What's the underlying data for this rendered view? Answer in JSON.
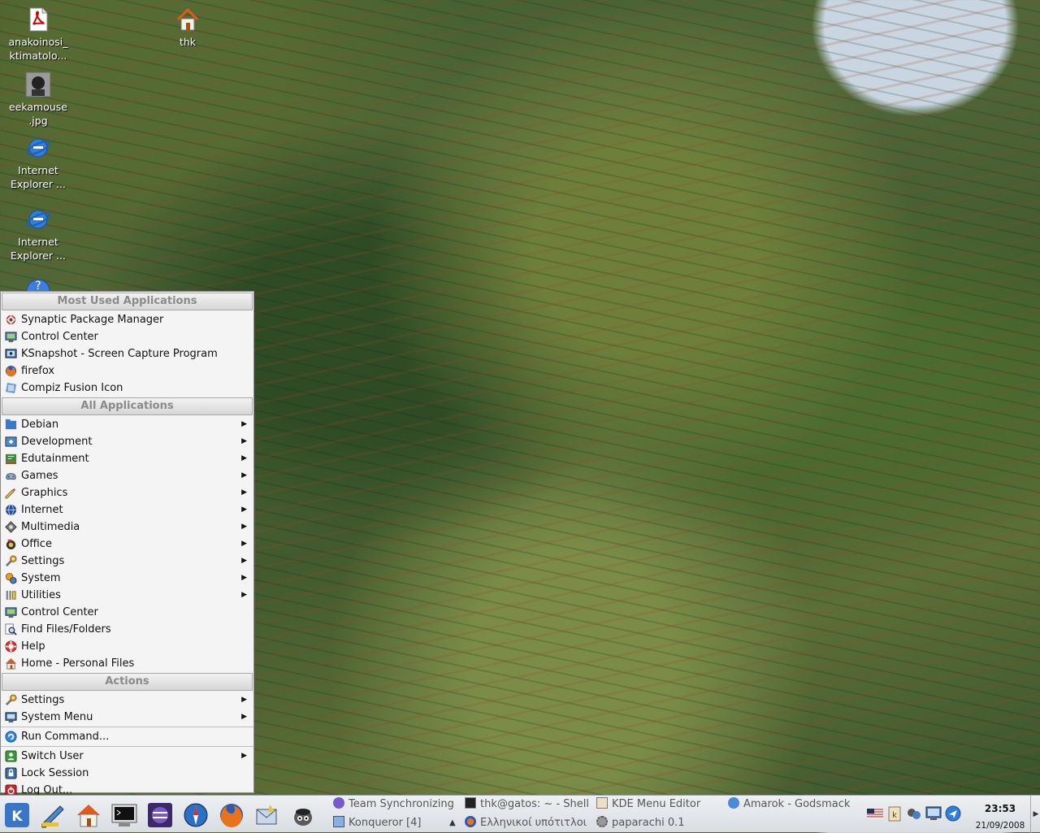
{
  "desktop": {
    "icons": [
      {
        "label_line1": "anakoinosi_",
        "label_line2": "ktimatolo...",
        "icon": "pdf-icon"
      },
      {
        "label_line1": "thk",
        "label_line2": "",
        "icon": "home-folder-icon"
      },
      {
        "label_line1": "eekamouse",
        "label_line2": ".jpg",
        "icon": "image-icon"
      },
      {
        "label_line1": "Internet",
        "label_line2": "Explorer ...",
        "icon": "internet-explorer-icon"
      },
      {
        "label_line1": "Internet",
        "label_line2": "Explorer ...",
        "icon": "internet-explorer-icon"
      }
    ]
  },
  "menu": {
    "sections": {
      "most_used": "Most Used Applications",
      "all_apps": "All Applications",
      "actions": "Actions"
    },
    "most_used": [
      {
        "label": "Synaptic Package Manager",
        "icon": "package-icon"
      },
      {
        "label": "Control Center",
        "icon": "control-center-icon"
      },
      {
        "label": "KSnapshot - Screen Capture Program",
        "icon": "camera-icon"
      },
      {
        "label": "firefox",
        "icon": "firefox-icon"
      },
      {
        "label": "Compiz Fusion Icon",
        "icon": "compiz-icon"
      }
    ],
    "all_apps": [
      {
        "label": "Debian",
        "icon": "debian-icon",
        "submenu": true
      },
      {
        "label": "Development",
        "icon": "development-icon",
        "submenu": true
      },
      {
        "label": "Edutainment",
        "icon": "edutainment-icon",
        "submenu": true
      },
      {
        "label": "Games",
        "icon": "games-icon",
        "submenu": true
      },
      {
        "label": "Graphics",
        "icon": "graphics-icon",
        "submenu": true
      },
      {
        "label": "Internet",
        "icon": "internet-icon",
        "submenu": true
      },
      {
        "label": "Multimedia",
        "icon": "multimedia-icon",
        "submenu": true
      },
      {
        "label": "Office",
        "icon": "office-icon",
        "submenu": true
      },
      {
        "label": "Settings",
        "icon": "settings-icon",
        "submenu": true
      },
      {
        "label": "System",
        "icon": "system-icon",
        "submenu": true
      },
      {
        "label": "Utilities",
        "icon": "utilities-icon",
        "submenu": true
      },
      {
        "label": "Control Center",
        "icon": "control-center-icon",
        "submenu": false
      },
      {
        "label": "Find Files/Folders",
        "icon": "find-icon",
        "submenu": false
      },
      {
        "label": "Help",
        "icon": "help-icon",
        "submenu": false
      },
      {
        "label": "Home - Personal Files",
        "icon": "home-icon",
        "submenu": false
      }
    ],
    "actions": [
      {
        "label": "Settings",
        "icon": "settings-icon",
        "submenu": true
      },
      {
        "label": "System Menu",
        "icon": "system-menu-icon",
        "submenu": true
      }
    ],
    "run_command": {
      "label": "Run Command...",
      "icon": "run-icon"
    },
    "session": [
      {
        "label": "Switch User",
        "icon": "switch-user-icon",
        "submenu": true
      },
      {
        "label": "Lock Session",
        "icon": "lock-icon",
        "submenu": false
      },
      {
        "label": "Log Out...",
        "icon": "logout-icon",
        "submenu": false
      }
    ]
  },
  "taskbar": {
    "launchers": [
      "kde-menu-icon",
      "kwrite-icon",
      "home-icon",
      "terminal-icon",
      "eclipse-icon",
      "browser-icon",
      "firefox-icon",
      "mail-icon",
      "gimp-icon"
    ],
    "tasks": [
      {
        "label": "Team Synchronizing",
        "icon": "eclipse-icon"
      },
      {
        "label": "thk@gatos: ~ - Shell",
        "icon": "terminal-icon"
      },
      {
        "label": "KDE Menu Editor",
        "icon": "menu-editor-icon"
      },
      {
        "label": "Amarok - Godsmack",
        "icon": "amarok-icon"
      },
      {
        "label": "Konqueror [4]",
        "icon": "konqueror-icon"
      },
      {
        "label": "Ελληνικοί υπότιτλοι σ",
        "icon": "firefox-icon"
      },
      {
        "label": "paparachi 0.1",
        "icon": "gear-icon"
      }
    ],
    "group_arrow": "▲",
    "tray": [
      "us-flag-icon",
      "klipper-icon",
      "network-icon",
      "display-icon",
      "wifi-icon"
    ],
    "clock": {
      "time": "23:53",
      "date": "21/09/2008"
    }
  }
}
